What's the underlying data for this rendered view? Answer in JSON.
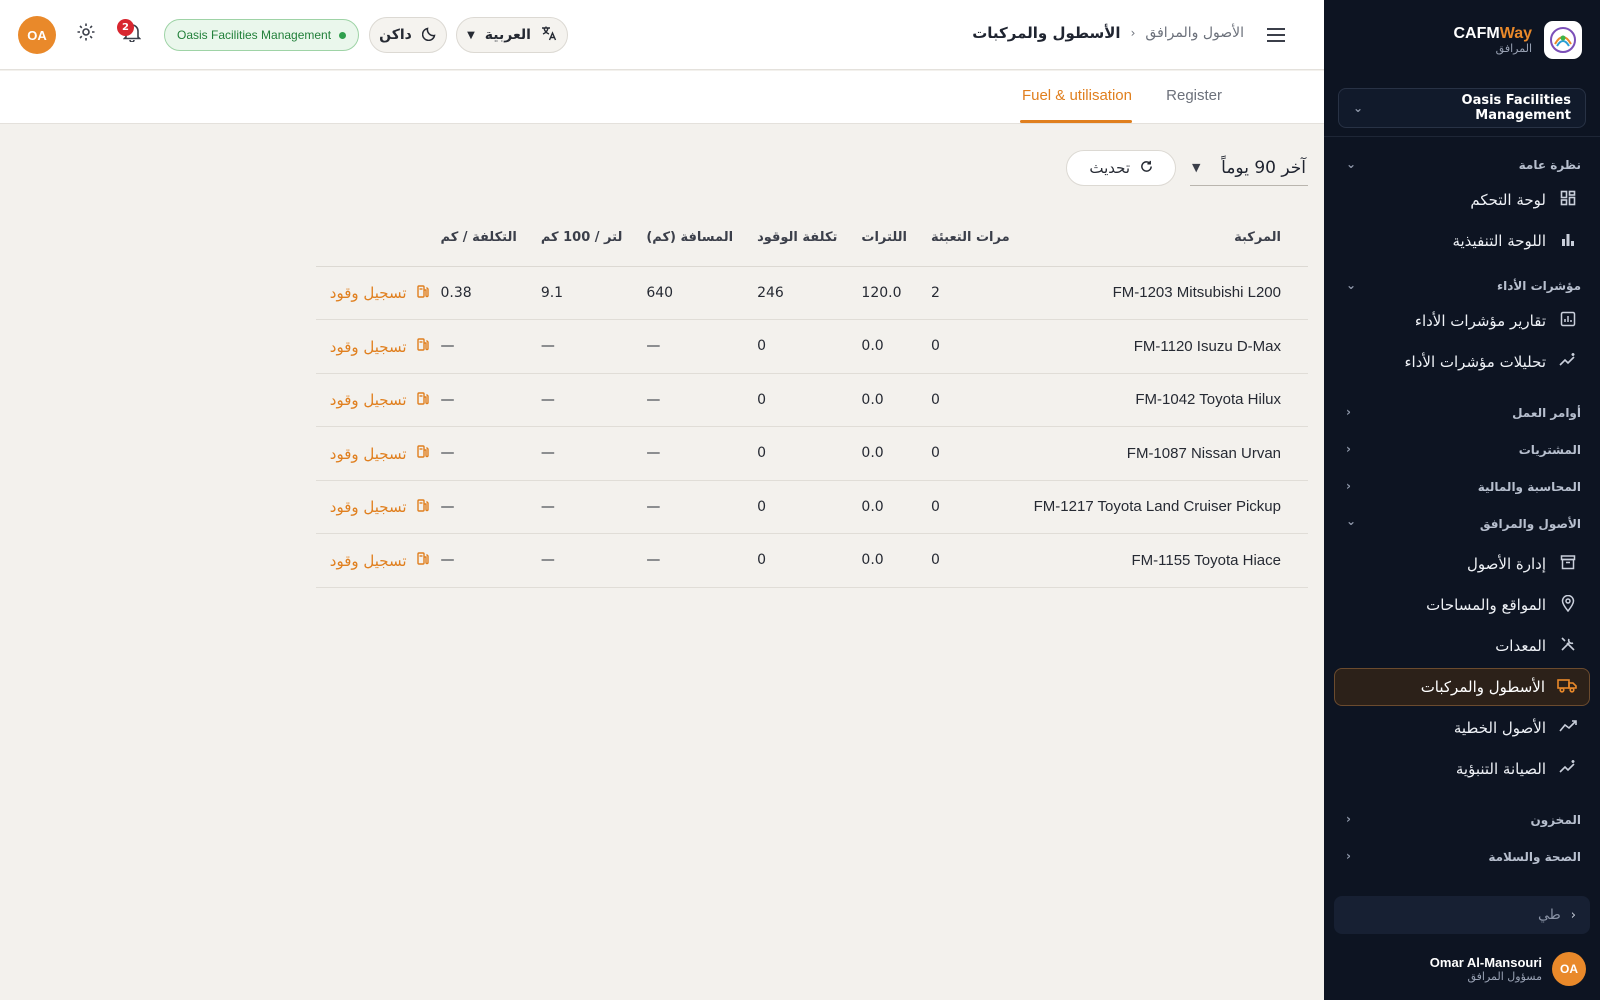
{
  "sidebar": {
    "brand_name_a": "CAFM",
    "brand_name_b": "Way",
    "brand_sub": "المرافق",
    "org": "Oasis Facilities Management",
    "groups": [
      {
        "label": "نظرة عامة",
        "items": [
          {
            "label": "لوحة التحكم",
            "icon": "dashboard-grid-icon",
            "glyph": "▦"
          },
          {
            "label": "اللوحة التنفيذية",
            "icon": "bar-chart-icon",
            "glyph": "▮"
          }
        ]
      },
      {
        "label": "مؤشرات الأداء",
        "items": [
          {
            "label": "تقارير مؤشرات الأداء",
            "icon": "report-chart-icon",
            "glyph": "◫"
          },
          {
            "label": "تحليلات مؤشرات الأداء",
            "icon": "analytics-sparkle-icon",
            "glyph": "↗"
          }
        ]
      },
      {
        "label": "أوامر العمل"
      },
      {
        "label": "المشتريات"
      },
      {
        "label": "المحاسبة والمالية"
      },
      {
        "label": "الأصول والمرافق",
        "items": [
          {
            "label": "إدارة الأصول",
            "icon": "archive-box-icon",
            "glyph": "▤"
          },
          {
            "label": "المواقع والمساحات",
            "icon": "map-pin-icon",
            "glyph": "⌖"
          },
          {
            "label": "المعدات",
            "icon": "tools-icon",
            "glyph": "✕"
          },
          {
            "label": "الأسطول والمركبات",
            "icon": "truck-icon",
            "glyph": "⛟"
          },
          {
            "label": "الأصول الخطية",
            "icon": "trend-line-icon",
            "glyph": "⟋"
          },
          {
            "label": "الصيانة التنبؤية",
            "icon": "predictive-sparkle-icon",
            "glyph": "✧"
          }
        ]
      },
      {
        "label": "المخزون"
      },
      {
        "label": "الصحة والسلامة"
      }
    ],
    "collapse_label": "طي",
    "user": {
      "initials": "OA",
      "name": "Omar Al-Mansouri",
      "role": "مسؤول المرافق"
    }
  },
  "header": {
    "breadcrumb_parent": "الأصول والمرافق",
    "breadcrumb_current": "الأسطول والمركبات",
    "language": "العربية",
    "theme": "داكن",
    "org_chip": "Oasis Facilities Management",
    "notifications_count": "2",
    "avatar_initials": "OA"
  },
  "tabs": {
    "register": "Register",
    "fuel": "Fuel & utilisation"
  },
  "controls": {
    "period": "آخر 90 يوماً",
    "refresh": "تحديث"
  },
  "table": {
    "headers": [
      "المركبة",
      "مرات التعبئة",
      "اللترات",
      "تكلفة الوقود",
      "المسافة (كم)",
      "لتر / 100 كم",
      "التكلفة / كم"
    ],
    "action_label": "تسجيل وقود",
    "rows": [
      [
        "FM-1203  Mitsubishi L200",
        "2",
        "120.0",
        "246",
        "640",
        "9.1",
        "0.38"
      ],
      [
        "FM-1120  Isuzu D-Max",
        "0",
        "0.0",
        "0",
        "—",
        "—",
        "—"
      ],
      [
        "FM-1042  Toyota Hilux",
        "0",
        "0.0",
        "0",
        "—",
        "—",
        "—"
      ],
      [
        "FM-1087  Nissan Urvan",
        "0",
        "0.0",
        "0",
        "—",
        "—",
        "—"
      ],
      [
        "FM-1217  Toyota Land Cruiser Pickup",
        "0",
        "0.0",
        "0",
        "—",
        "—",
        "—"
      ],
      [
        "FM-1155  Toyota Hiace",
        "0",
        "0.0",
        "0",
        "—",
        "—",
        "—"
      ]
    ]
  },
  "colors": {
    "accent": "#e07f1e",
    "sidebar_bg": "#0d1422",
    "success": "#22803a"
  }
}
